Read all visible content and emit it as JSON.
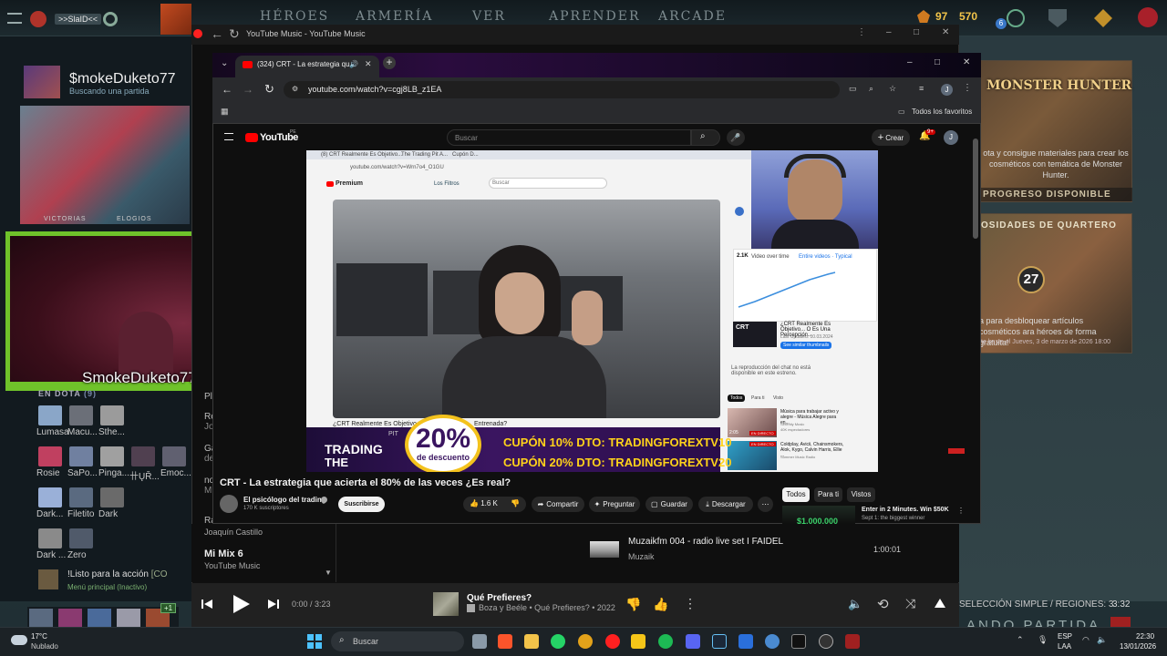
{
  "dota": {
    "nav": [
      "HÉROES",
      "ARMERÍA",
      "VER",
      "APRENDER",
      "ARCADE"
    ],
    "party_label": ">>SlaID<<",
    "currency": "97",
    "currency2": "570",
    "notif_count": "6",
    "profile": {
      "name": "$mokeDuketo77",
      "status": "Buscando una partida",
      "label_victorias": "VICTORIAS",
      "label_elogios": "ELOGIOS"
    },
    "webcam_name": "SmokeDuketo77",
    "friends_header": "EN DOTA",
    "friends_count": "(9)",
    "friends": [
      {
        "name": "Lumasa",
        "color": "#8aa6c8"
      },
      {
        "name": "Macu...",
        "color": "#6b6f78"
      },
      {
        "name": "Sthe...",
        "color": "#9b9b9b"
      },
      {
        "name": "Rosie",
        "color": "#c04060"
      },
      {
        "name": "SaPo...",
        "color": "#7080a0"
      },
      {
        "name": "Pinga...",
        "color": "#a0a0a0"
      },
      {
        "name": "卄ŲŘ...",
        "color": "#504050"
      },
      {
        "name": "Emoc...",
        "color": "#606070"
      },
      {
        "name": "Dark...",
        "color": "#9ab0d8"
      },
      {
        "name": "Filetito",
        "color": "#5a6a80"
      },
      {
        "name": "Dark",
        "color": "#6a6a6a"
      },
      {
        "name": "Dark ...",
        "color": "#8a8a8a"
      },
      {
        "name": "Zero",
        "color": "#505a6a"
      }
    ],
    "chat_line1": "!Listo para la acción",
    "chat_line1b": "[CO",
    "chat_line2": "Menú principal (Inactivo)",
    "plus_badge": "+1",
    "promo1": {
      "title": "MONSTER HUNTER",
      "text": "ota y consigue materiales para crear los cosméticos con temática de Monster Hunter.",
      "caption": "PROGRESO DISPONIBLE"
    },
    "promo2": {
      "header": "OSIDADES DE QUARTERO",
      "badge": "27",
      "text": "a para desbloquear artículos cosméticos ara héroes de forma gratuita!",
      "date_prefix": "te hasta el",
      "date": "Jueves, 3 de marzo de 2026 18:00"
    },
    "bottom_right_status": "SELECCIÓN SIMPLE / REGIONES: 3",
    "bottom_right_time": "3:32",
    "finding": "ANDO PARTIDA"
  },
  "ytm": {
    "title": "YouTube Music - YouTube Music",
    "side_labels": [
      "Pl",
      "Re",
      "Jo",
      "Ga",
      "de",
      "no",
      "Mi",
      "Ra"
    ],
    "row1": {
      "artist": "Joaquín Castillo"
    },
    "row2": {
      "title": "Mi Mix 6",
      "subtitle": "YouTube Music"
    },
    "queue_track": {
      "title": "Muzaikfm 004 - radio live set I FAIDEL",
      "artist": "Muzaik",
      "duration": "1:00:01"
    },
    "player": {
      "time": "0:00 / 3:23",
      "title": "Qué Prefieres?",
      "meta": "Boza y Beéle • Qué Prefieres? • 2022"
    }
  },
  "chrome": {
    "tab_title": "(324) CRT - La estrategia qu",
    "url": "youtube.com/watch?v=cgj8LB_z1EA",
    "bookmarks": "Todos los favoritos",
    "profile_letter": "J"
  },
  "youtube": {
    "logo": "YouTube",
    "logo_sup": "PE",
    "search_placeholder": "Buscar",
    "create_label": "Crear",
    "notif_badge": "9+",
    "video_title": "CRT - La estrategia que acierta el 80% de las veces ¿Es real?",
    "channel": "El psicólogo del trading",
    "subs": "170 K suscriptores",
    "subscribe": "Suscribirse",
    "likes": "1.6 K",
    "actions": {
      "share": "Compartir",
      "ask": "Preguntar",
      "save": "Guardar",
      "download": "Descargar"
    },
    "tabs": [
      "Todos",
      "Para ti",
      "Vistos"
    ],
    "side_ad": {
      "title": "Enter in 2 Minutes. Win $50K",
      "sub": "Sept 1: the biggest winner",
      "amount": "$1,000,000"
    },
    "overlay": {
      "percent": "20%",
      "percent_sub": "de descuento",
      "pit": "PIT",
      "trading": "TRADING",
      "the": "THE",
      "coupon1_label": "CUPÓN 10% DTO:",
      "coupon1_code": "TRADINGFOREXTV10",
      "coupon2_label": "CUPÓN 20% DTO:",
      "coupon2_code": "TRADINGFOREXTV20"
    },
    "inner": {
      "premium": "Premium",
      "search": "Buscar",
      "filter": "Los Filtros",
      "url": "youtube.com/watch?v=Wrn7o4_O1GU",
      "tab1": "(8) CRT Realmente Es Objetivo...",
      "tab2": "The Trading Pit A...",
      "tab3": "Cupón D...",
      "caption": "¿CRT Realmente Es Objetivo",
      "caption2": "Entrenada?",
      "chart_label": "2.1K",
      "chart_opt": "Video over time",
      "chart_opt2": "Entire videos · Typical",
      "card_title": "¿CRT Realmente Es Objetivo... O Es Una Percepción...",
      "card_sub": "Last Updated: 10.03.2024",
      "card_btn": "See similar thumbnails",
      "card_thumb": "CRT",
      "unavailable": "La reproducción del chat no está disponible en este estreno.",
      "tabs": [
        "Todos",
        "Para ti",
        "Visto"
      ],
      "rec1_title": "Música para trabajar activo y alegre - Música Alegre para en...",
      "rec1_ch": "Serenity Music",
      "rec1_meta": "40K espectadores",
      "rec1_badge": "EN DIRECTO",
      "rec2_title": "Coldplay, Avicii, Chainsmokers, Alok, Kygo, Calvin Harris, Ellie ...",
      "rec2_ch": "Summer Music Radio",
      "rec2_time": "2:05",
      "rec2_badge": "EN DIRECTO"
    }
  },
  "taskbar": {
    "weather_temp": "17°C",
    "weather_desc": "Nublado",
    "search": "Buscar",
    "lang": "ESP",
    "lang2": "LAA",
    "time": "22:30",
    "date": "13/01/2026"
  },
  "colors": {
    "yt_red": "#ff0000",
    "overlay_purple": "#3a1560",
    "coupon_yellow": "#ffd21a",
    "badge_yellow": "#f3c21d"
  }
}
